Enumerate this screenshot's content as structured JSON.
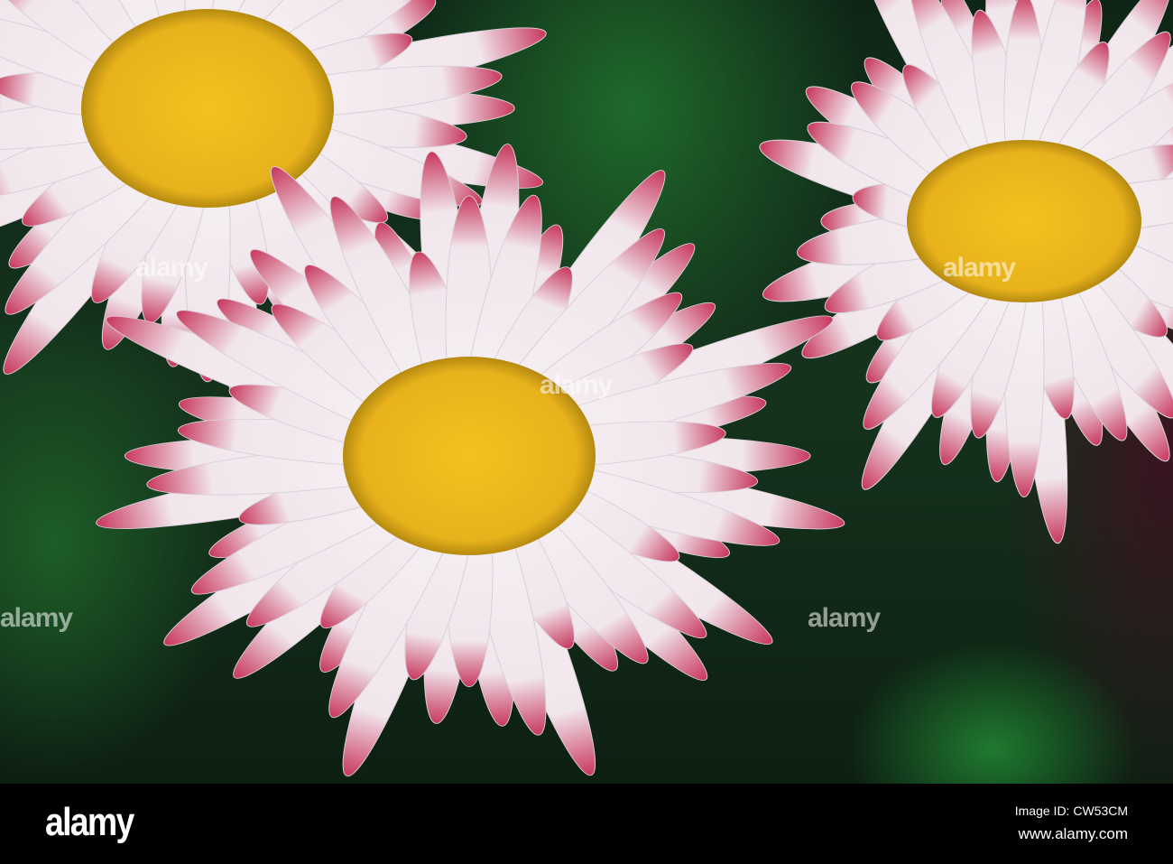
{
  "photo": {
    "subject": "daisies",
    "watermark_text": "alamy",
    "colors": {
      "petal": "#f7f4f6",
      "petal_tip": "#c8385e",
      "center": "#e8b21c",
      "background": "#14331c"
    }
  },
  "footer": {
    "logo": "alamy",
    "image_id": "Image ID: CW53CM",
    "url": "www.alamy.com"
  }
}
